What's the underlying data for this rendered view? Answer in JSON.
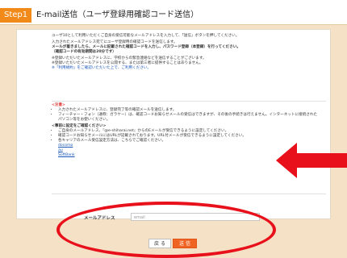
{
  "header": {
    "step": "Step1",
    "title": "E-mail送信（ユーザ登録用確認コード送信）"
  },
  "intro": [
    "ユーザ10として利用いただくご自身の受信可能なメールアドレスを入力して、「送信」ボタンを押してください。",
    "入力されたメールアドレス宛てにユーザ登録用の確認コードを送信します。",
    "メールが着きましたら、メールに記載された確認コードを入力し、パスワード登録（本登録）を行ってください。",
    "（確認コードの有効期間は20分です）",
    "※登録いただいたメールアドレスに、学校からの緊急連絡などを送信することがございます。",
    "※登録いただいたメールアドレスを公開する、または第三者に提供することはありません。",
    "※「利用規約」をご確認いただいた上で、ご利用ください。"
  ],
  "caution": {
    "header": "<注意>",
    "items": [
      "入力されたメールアドレスに、登録完了等の確認メールを送信します。",
      "フィーチャー・フォン（通称：ガラケー）は、確認コードお知らせメールの受信はできますが、その後の手続きは行えません。インターネットに接続されたパソコン等をお使いください。"
    ],
    "prep_header": "<事前に設定をご確認ください>",
    "prep_items": [
      "ご自身のメールアドレス、『@e-shiharai.net』からのEメールが受信できるように設定してください。",
      "確認コードお知らせメールにはURLが記載されております。URL付メールが受信できるように設定してください。",
      "各キャリアのメール受信設定方法は、こちらでご確認ください。"
    ],
    "carriers": [
      "docomo",
      "au",
      "SoftBank"
    ]
  },
  "form": {
    "email_label": "メールアドレス",
    "email_placeholder": "email"
  },
  "buttons": {
    "back": "戻 る",
    "send": "送 信"
  },
  "colors": {
    "step_badge": "#f28a1a",
    "highlight": "#e8101a",
    "send_button": "#f06423",
    "background": "#f5e2c6"
  }
}
